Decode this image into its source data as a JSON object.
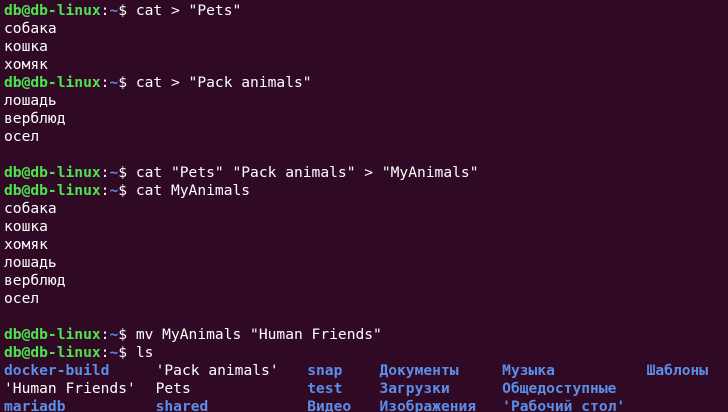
{
  "theme": {
    "background": "#300a24",
    "text": "#ffffff",
    "user_color": "#4ee34e",
    "path_color": "#5b8ee8",
    "dir_color": "#5b8ee8"
  },
  "prompt": {
    "user_host": "db@db-linux",
    "colon": ":",
    "path": "~",
    "symbol": "$ "
  },
  "lines": [
    {
      "type": "cmd",
      "command": "cat > \"Pets\""
    },
    {
      "type": "out",
      "text": "собака"
    },
    {
      "type": "out",
      "text": "кошка"
    },
    {
      "type": "out",
      "text": "хомяк"
    },
    {
      "type": "cmd",
      "command": "cat > \"Pack animals\""
    },
    {
      "type": "out",
      "text": "лошадь"
    },
    {
      "type": "out",
      "text": "верблюд"
    },
    {
      "type": "out",
      "text": "осел"
    },
    {
      "type": "out",
      "text": ""
    },
    {
      "type": "cmd",
      "command": "cat \"Pets\" \"Pack animals\" > \"MyAnimals\""
    },
    {
      "type": "cmd",
      "command": "cat MyAnimals"
    },
    {
      "type": "out",
      "text": "собака"
    },
    {
      "type": "out",
      "text": "кошка"
    },
    {
      "type": "out",
      "text": "хомяк"
    },
    {
      "type": "out",
      "text": "лошадь"
    },
    {
      "type": "out",
      "text": "верблюд"
    },
    {
      "type": "out",
      "text": "осел"
    },
    {
      "type": "out",
      "text": ""
    },
    {
      "type": "cmd",
      "command": "mv MyAnimals \"Human Friends\""
    },
    {
      "type": "cmd",
      "command": "ls"
    }
  ],
  "ls_output": {
    "rows": [
      [
        {
          "name": "docker-build",
          "dir": true
        },
        {
          "name": "'Pack animals'",
          "dir": false
        },
        {
          "name": "snap",
          "dir": true
        },
        {
          "name": "Документы",
          "dir": true
        },
        {
          "name": "Музыка",
          "dir": true
        },
        {
          "name": "Шаблоны",
          "dir": true
        }
      ],
      [
        {
          "name": "'Human Friends'",
          "dir": false
        },
        {
          "name": "Pets",
          "dir": false
        },
        {
          "name": "test",
          "dir": true
        },
        {
          "name": "Загрузки",
          "dir": true
        },
        {
          "name": "Общедоступные",
          "dir": true
        },
        {
          "name": "",
          "dir": false
        }
      ],
      [
        {
          "name": "mariadb",
          "dir": true
        },
        {
          "name": "shared",
          "dir": true
        },
        {
          "name": "Видео",
          "dir": true
        },
        {
          "name": "Изображения",
          "dir": true
        },
        {
          "name": "'Рабочий стол'",
          "dir": true
        },
        {
          "name": "",
          "dir": false
        }
      ]
    ]
  }
}
